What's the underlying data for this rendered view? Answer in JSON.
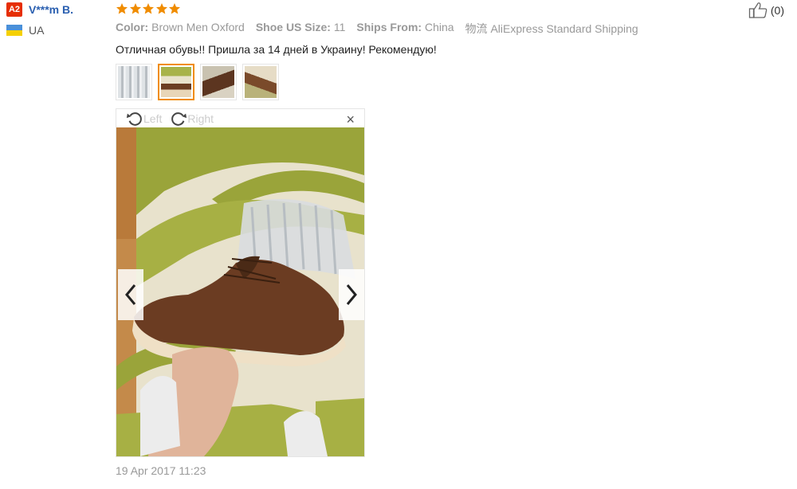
{
  "reviewer": {
    "level": "A2",
    "name": "V***m B.",
    "country": "UA",
    "flag_colors": [
      "#4a90d9",
      "#f5d000"
    ]
  },
  "rating": {
    "stars": 5,
    "max": 5,
    "color": "#f08c00"
  },
  "attributes": [
    {
      "label": "Color:",
      "value": "Brown Men Oxford"
    },
    {
      "label": "Shoe US Size:",
      "value": "11"
    },
    {
      "label": "Ships From:",
      "value": "China"
    },
    {
      "label": "物流",
      "value": "AliExpress Standard Shipping"
    }
  ],
  "feedback_text": "Отличная обувь!! Пришла за 14 дней в Украину! Рекомендую!",
  "thumbnails": [
    {
      "icon": "photo-thumb-packaging",
      "active": false
    },
    {
      "icon": "photo-thumb-shoe-hand",
      "active": true
    },
    {
      "icon": "photo-thumb-shoe-side",
      "active": false
    },
    {
      "icon": "photo-thumb-shoe-pair",
      "active": false
    }
  ],
  "viewer": {
    "rotate_left_label": "Left",
    "rotate_right_label": "Right",
    "close_symbol": "×"
  },
  "review_date": "19 Apr 2017 11:23",
  "helpful": {
    "count_label": "(0)"
  }
}
